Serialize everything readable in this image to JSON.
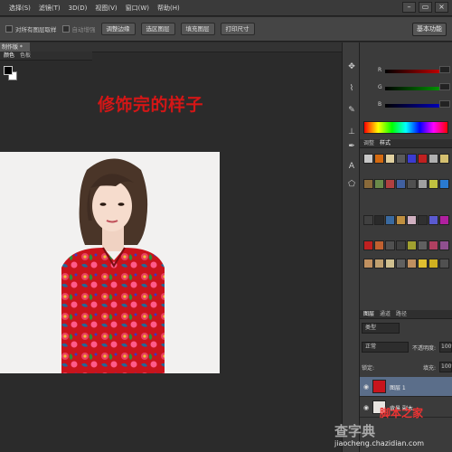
{
  "menu": [
    "选择(S)",
    "滤镜(T)",
    "3D(D)",
    "视图(V)",
    "窗口(W)",
    "帮助(H)"
  ],
  "window_controls": [
    "–",
    "▭",
    "×"
  ],
  "options_bar": {
    "sample_all_layers": "对所有图层取样",
    "auto_enhance": "自动增强",
    "buttons": [
      "调整边缘",
      "选区图层",
      "填充图层",
      "打印尺寸"
    ],
    "workspace": "基本功能"
  },
  "document": {
    "tab_label": "制作版 *"
  },
  "canvas": {
    "heading": "修饰完的样子",
    "heading_color": "#d41616",
    "photo_bg": "#f2f1f0"
  },
  "tools": [
    "move-icon",
    "lasso-icon",
    "brush-icon",
    "stamp-icon",
    "pen-icon",
    "type-icon",
    "shape-icon"
  ],
  "color_panel": {
    "tabs": [
      "颜色",
      "色板"
    ],
    "sliders": [
      {
        "label": "R",
        "color": "#d00000"
      },
      {
        "label": "G",
        "color": "#00a000"
      },
      {
        "label": "B",
        "color": "#0000c8"
      }
    ]
  },
  "styles_panel": {
    "tabs": [
      "调整",
      "样式"
    ],
    "swatches": [
      "#c8c8c8",
      "#d46a10",
      "#e0d0a0",
      "#5a5a5a",
      "#3b3bd0",
      "#c02020",
      "#b0b0b0",
      "#d4c070",
      "#8a6a3a",
      "#6a8a4a",
      "#b04040",
      "#4060a0",
      "#505050",
      "#a0a0a0",
      "#c0c040",
      "#2a7ad0",
      "#404040",
      "#2a2a2a",
      "#3a6aa0",
      "#c09040",
      "#d0b0c0",
      "#303030",
      "#5a5ad0",
      "#b020a0",
      "#c02020",
      "#c06030",
      "#505050",
      "#404040",
      "#a0a030",
      "#606060",
      "#b04060",
      "#905090",
      "#c09060",
      "#c0a070",
      "#d0c090",
      "#606060",
      "#c09060",
      "#e0c030",
      "#d0b020",
      "#505050"
    ]
  },
  "layers_panel": {
    "tabs": [
      "图层",
      "通道",
      "路径"
    ],
    "kind_filter": "类型",
    "blend_mode": "正常",
    "opacity_label": "不透明度:",
    "opacity_value": "100%",
    "lock_label": "锁定:",
    "fill_label": "填充:",
    "fill_value": "100%",
    "layers": [
      {
        "name": "图层 1",
        "selected": true
      },
      {
        "name": "背景 副本",
        "selected": false
      }
    ]
  },
  "watermark": {
    "main": "查字典",
    "secondary": "脚本之家",
    "url": "jiaocheng.chazidian.com"
  }
}
